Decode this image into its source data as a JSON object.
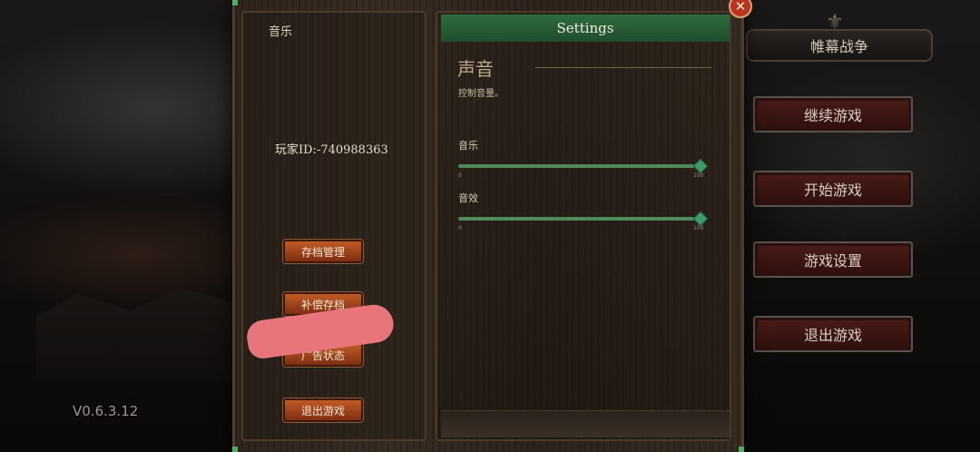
{
  "left_panel": {
    "title": "音乐",
    "player_id": "玩家ID:-740988363",
    "buttons": [
      {
        "label": "存档管理"
      },
      {
        "label": "补偿存档"
      },
      {
        "label": "广告状态"
      },
      {
        "label": "退出游戏"
      }
    ]
  },
  "settings": {
    "header": "Settings",
    "section_title": "声音",
    "section_desc": "控制音量。",
    "sliders": [
      {
        "label": "音乐",
        "min": "0",
        "max": "100",
        "value": 100
      },
      {
        "label": "音效",
        "min": "0",
        "max": "100",
        "value": 100
      }
    ]
  },
  "main_menu": {
    "title": "帷幕战争",
    "buttons": [
      {
        "label": "继续游戏"
      },
      {
        "label": "开始游戏"
      },
      {
        "label": "游戏设置"
      },
      {
        "label": "退出游戏"
      }
    ]
  },
  "version": "V0.6.3.12",
  "close_icon": "close-icon",
  "colors": {
    "accent_green": "#2f6b3f",
    "button_orange": "#c05a25",
    "menu_button_red": "#4a1c18"
  }
}
